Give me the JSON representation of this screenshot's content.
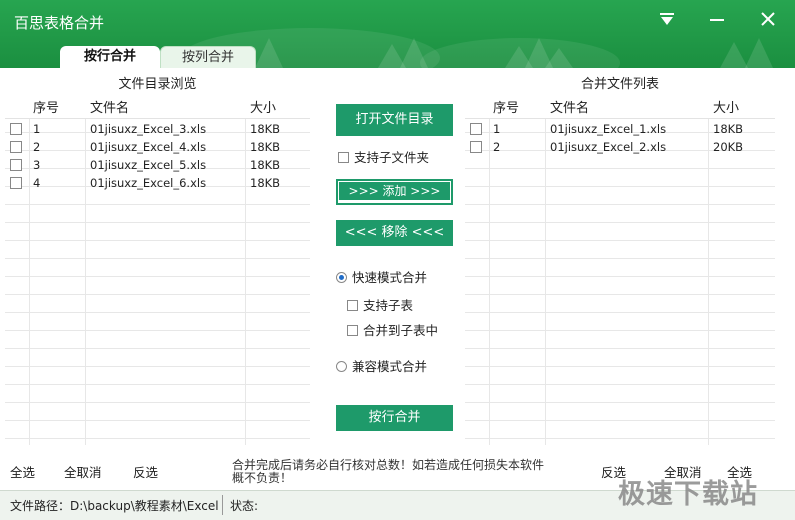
{
  "window": {
    "title": "百思表格合并",
    "menu_icon": "dropdown-triangle-icon",
    "minimize_icon": "minimize-icon",
    "close_icon": "close-icon"
  },
  "tabs": [
    {
      "label": "按行合并",
      "active": true
    },
    {
      "label": "按列合并",
      "active": false
    }
  ],
  "left_panel": {
    "title": "文件目录浏览",
    "columns": [
      "序号",
      "文件名",
      "大小"
    ],
    "rows": [
      {
        "index": "1",
        "name": "01jisuxz_Excel_3.xls",
        "size": "18KB",
        "checked": false
      },
      {
        "index": "2",
        "name": "01jisuxz_Excel_4.xls",
        "size": "18KB",
        "checked": false
      },
      {
        "index": "3",
        "name": "01jisuxz_Excel_5.xls",
        "size": "18KB",
        "checked": false
      },
      {
        "index": "4",
        "name": "01jisuxz_Excel_6.xls",
        "size": "18KB",
        "checked": false
      }
    ]
  },
  "right_panel": {
    "title": "合并文件列表",
    "columns": [
      "序号",
      "文件名",
      "大小"
    ],
    "rows": [
      {
        "index": "1",
        "name": "01jisuxz_Excel_1.xls",
        "size": "18KB",
        "checked": false
      },
      {
        "index": "2",
        "name": "01jisuxz_Excel_2.xls",
        "size": "20KB",
        "checked": false
      }
    ]
  },
  "controls": {
    "open_dir": "打开文件目录",
    "include_subfolders": "支持子文件夹",
    "add": ">>> 添加 >>>",
    "remove": "<<< 移除 <<<",
    "fast_mode": "快速模式合并",
    "support_sheets": "支持子表",
    "merge_into_sheet": "合并到子表中",
    "compat_mode": "兼容模式合并",
    "merge_button": "按行合并"
  },
  "bottom": {
    "left_select_all": "全选",
    "left_deselect_all": "全取消",
    "left_invert": "反选",
    "notice": "合并完成后请务必自行核对总数！如若造成任何损失本软件概不负责！",
    "right_invert": "反选",
    "right_deselect_all": "全取消",
    "right_select_all": "全选"
  },
  "statusbar": {
    "path_label": "文件路径：D:\\backup\\教程素材\\Excel",
    "status_label": "状态:"
  },
  "watermark": "极速下载站",
  "colors": {
    "titlebar": "#1f9a47",
    "button": "#1e9a6a"
  }
}
